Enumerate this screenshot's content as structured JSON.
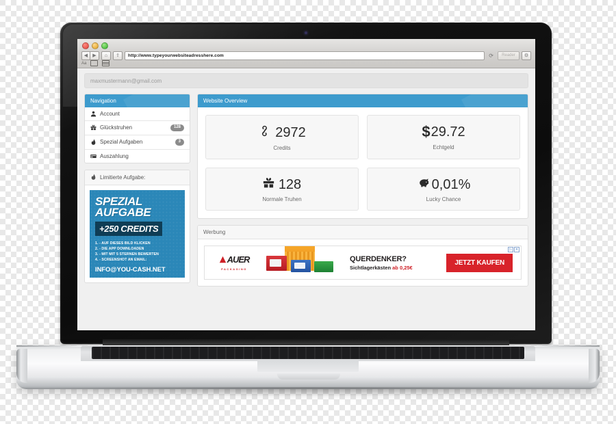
{
  "browser": {
    "url": "http://www.typeyourwebsiteadresshere.com",
    "reader_label": "Reader",
    "back_icon": "◀",
    "forward_icon": "▶",
    "home_icon": "⌂",
    "share_icon": "⇪",
    "reload_icon": "⟳",
    "settings_icon": "⚙",
    "bookmark_text_icon": "Aa",
    "bookmark_book_icon": "▭",
    "bookmark_grid_icon": "▤"
  },
  "account": {
    "email": "maxmustermann@gmail.com"
  },
  "sidebar": {
    "title": "Navigation",
    "items": [
      {
        "label": "Account",
        "icon": "user-icon",
        "glyph": "👤",
        "badge": ""
      },
      {
        "label": "Glückstruhen",
        "icon": "gift-icon",
        "glyph": "🎁",
        "badge": "128"
      },
      {
        "label": "Spezial Aufgaben",
        "icon": "flame-icon",
        "glyph": "🔥",
        "badge": "3"
      },
      {
        "label": "Auszahlung",
        "icon": "card-icon",
        "glyph": "💳",
        "badge": ""
      }
    ],
    "limited_title": "Limitierte Aufgabe:",
    "limited_icon": "flame-icon",
    "promo": {
      "line1": "SPEZIAL",
      "line2": "AUFGABE",
      "credits": "+250 CREDITS",
      "steps": [
        "1. - AUF DIESES BILD KLICKEN",
        "2. - DIE APP DOWNLOADEN",
        "3. - MIT MIT 5 STERNEN BEWERTEN",
        "4. - SCREENSHOT AN EMAIL:"
      ],
      "email": "INFO@YOU-CASH.NET",
      "bg_color": "#2b87b8",
      "badge_color": "#0f3d55"
    }
  },
  "overview": {
    "title": "Website Overview",
    "accent_color": "#3d9bcd",
    "stats": [
      {
        "value": "2972",
        "caption": "Credits",
        "icon": "link-chain-icon"
      },
      {
        "value": "29.72",
        "caption": "Echtgeld",
        "icon": "dollar-icon",
        "prefix": "$"
      },
      {
        "value": "128",
        "caption": "Normale Truhen",
        "icon": "gift-box-icon"
      },
      {
        "value": "0,01%",
        "caption": "Lucky Chance",
        "icon": "piggy-bank-icon"
      }
    ]
  },
  "advertising": {
    "title": "Werbung",
    "brand": "AUER",
    "brand_sub": "PACKAGING",
    "headline": "QUERDENKER?",
    "subline": "Sichtlagerkästen",
    "price": "ab 0,25€",
    "cta": "JETZT KAUFEN",
    "adchoices": "▷",
    "close": "✕",
    "brand_color": "#cf2027",
    "cta_color": "#d8232a"
  }
}
